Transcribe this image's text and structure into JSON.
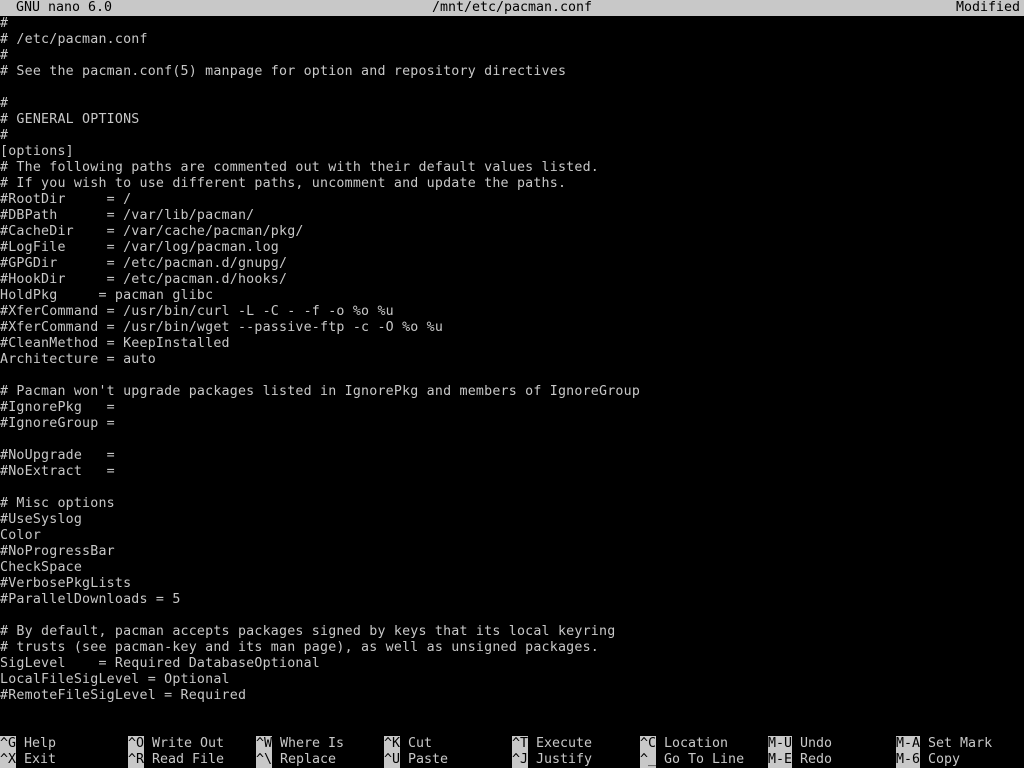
{
  "titlebar": {
    "version": "GNU nano 6.0",
    "filename": "/mnt/etc/pacman.conf",
    "status": "Modified"
  },
  "lines": [
    "#",
    "# /etc/pacman.conf",
    "#",
    "# See the pacman.conf(5) manpage for option and repository directives",
    "",
    "#",
    "# GENERAL OPTIONS",
    "#",
    "[options]",
    "# The following paths are commented out with their default values listed.",
    "# If you wish to use different paths, uncomment and update the paths.",
    "#RootDir     = /",
    "#DBPath      = /var/lib/pacman/",
    "#CacheDir    = /var/cache/pacman/pkg/",
    "#LogFile     = /var/log/pacman.log",
    "#GPGDir      = /etc/pacman.d/gnupg/",
    "#HookDir     = /etc/pacman.d/hooks/",
    "HoldPkg     = pacman glibc",
    "#XferCommand = /usr/bin/curl -L -C - -f -o %o %u",
    "#XferCommand = /usr/bin/wget --passive-ftp -c -O %o %u",
    "#CleanMethod = KeepInstalled",
    "Architecture = auto",
    "",
    "# Pacman won't upgrade packages listed in IgnorePkg and members of IgnoreGroup",
    "#IgnorePkg   =",
    "#IgnoreGroup =",
    "",
    "#NoUpgrade   =",
    "#NoExtract   =",
    "",
    "# Misc options",
    "#UseSyslog",
    "Color",
    "#NoProgressBar",
    "CheckSpace",
    "#VerbosePkgLists",
    "#ParallelDownloads = 5",
    "",
    "# By default, pacman accepts packages signed by keys that its local keyring",
    "# trusts (see pacman-key and its man page), as well as unsigned packages.",
    "SigLevel    = Required DatabaseOptional",
    "LocalFileSigLevel = Optional",
    "#RemoteFileSigLevel = Required"
  ],
  "shortcuts": [
    [
      {
        "key": "^G",
        "label": "Help"
      },
      {
        "key": "^O",
        "label": "Write Out"
      },
      {
        "key": "^W",
        "label": "Where Is"
      },
      {
        "key": "^K",
        "label": "Cut"
      },
      {
        "key": "^T",
        "label": "Execute"
      },
      {
        "key": "^C",
        "label": "Location"
      },
      {
        "key": "M-U",
        "label": "Undo"
      },
      {
        "key": "M-A",
        "label": "Set Mark"
      }
    ],
    [
      {
        "key": "^X",
        "label": "Exit"
      },
      {
        "key": "^R",
        "label": "Read File"
      },
      {
        "key": "^\\",
        "label": "Replace"
      },
      {
        "key": "^U",
        "label": "Paste"
      },
      {
        "key": "^J",
        "label": "Justify"
      },
      {
        "key": "^_",
        "label": "Go To Line"
      },
      {
        "key": "M-E",
        "label": "Redo"
      },
      {
        "key": "M-6",
        "label": "Copy"
      }
    ]
  ],
  "colors": {
    "background": "#000000",
    "text": "#c8c8c8",
    "inverse_bg": "#c8c8c8",
    "inverse_text": "#000000"
  }
}
